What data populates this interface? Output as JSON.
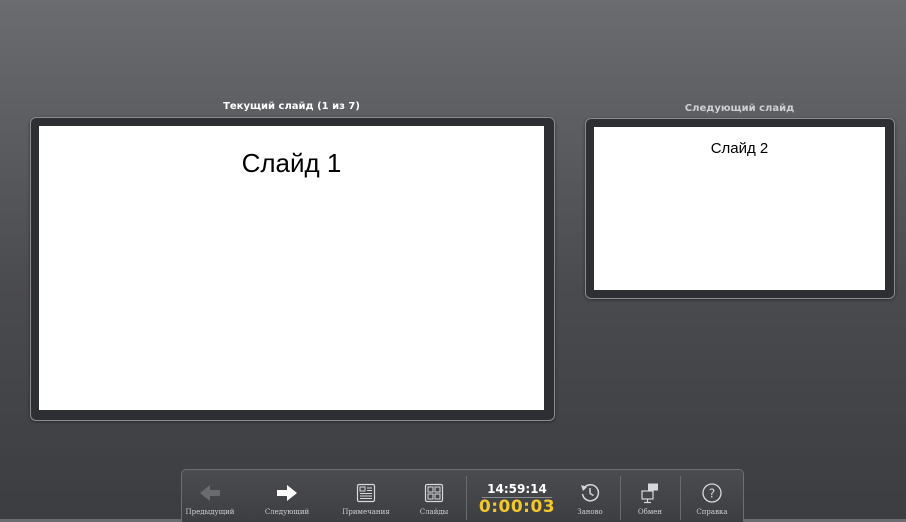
{
  "current": {
    "title": "Текущий слайд (1 из 7)",
    "slide_text": "Слайд 1"
  },
  "next": {
    "title": "Следующий слайд",
    "slide_text": "Слайд 2"
  },
  "toolbar": {
    "prev_label": "Предыдущий",
    "next_label": "Следующий",
    "notes_label": "Примечания",
    "slides_label": "Слайды",
    "clock": "14:59:14",
    "timer": "0:00:03",
    "restart_label": "Заново",
    "switch_label": "Обмен",
    "help_label": "Справка"
  },
  "icons": {
    "prev": "arrow-left-icon",
    "next": "arrow-right-icon",
    "notes": "notes-icon",
    "slides": "slides-grid-icon",
    "restart": "restart-clock-icon",
    "switch": "swap-monitors-icon",
    "help": "help-icon"
  },
  "colors": {
    "timer": "#f2c82b",
    "clock": "#ffffff"
  }
}
